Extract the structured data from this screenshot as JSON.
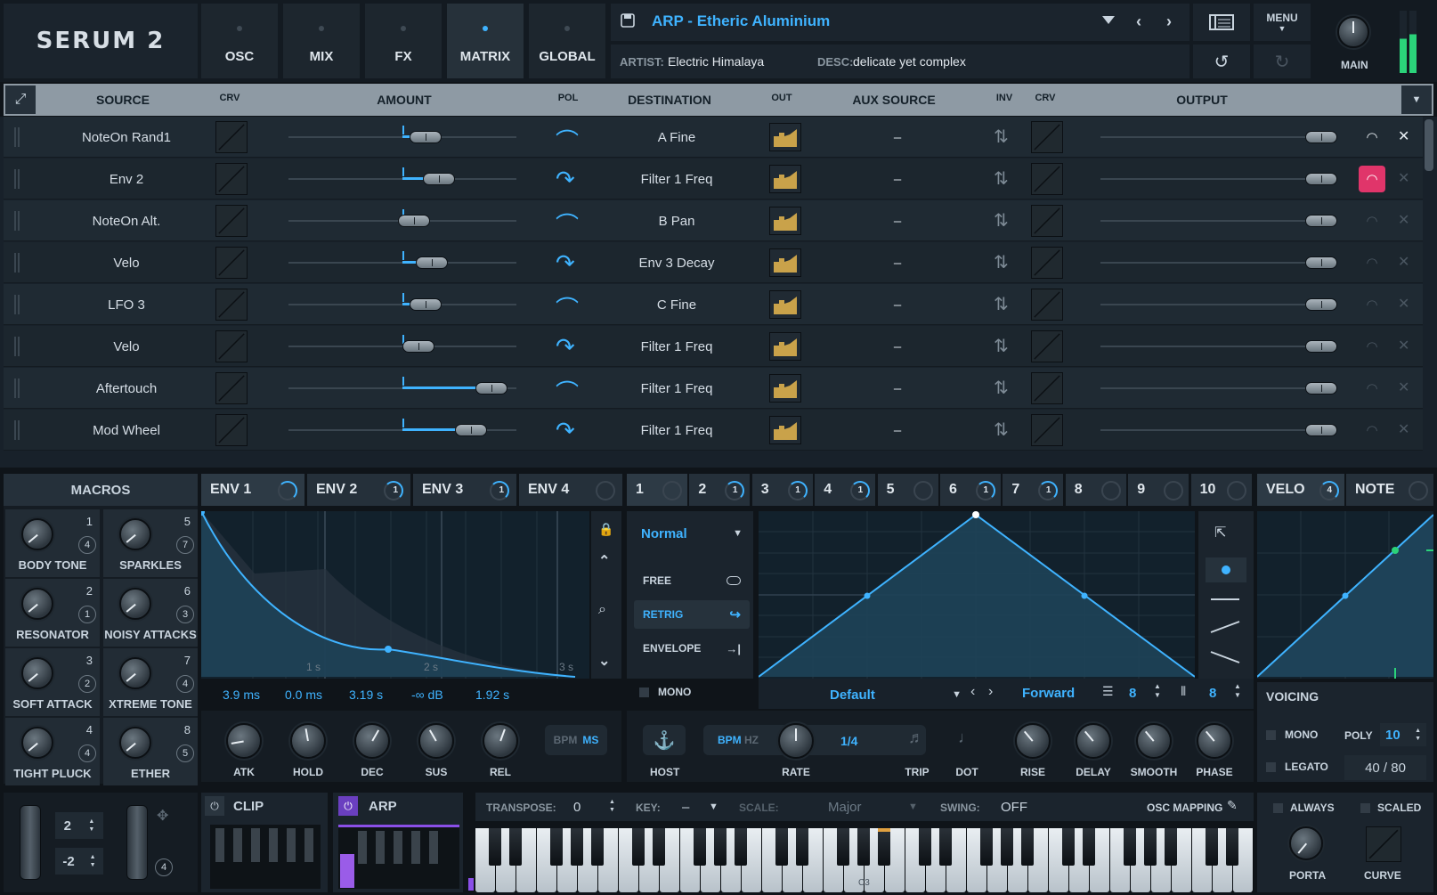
{
  "app": {
    "logo": "SERUM 2"
  },
  "tabs": [
    {
      "label": "OSC",
      "active": false
    },
    {
      "label": "MIX",
      "active": false
    },
    {
      "label": "FX",
      "active": false
    },
    {
      "label": "MATRIX",
      "active": true
    },
    {
      "label": "GLOBAL",
      "active": false
    }
  ],
  "preset": {
    "name": "ARP - Etheric Aluminium",
    "artist_label": "ARTIST:",
    "artist": "Electric Himalaya",
    "desc_label": "DESC:",
    "desc": "delicate yet complex"
  },
  "menu_label": "MENU",
  "main_label": "MAIN",
  "matrix": {
    "headers": {
      "source": "SOURCE",
      "crv": "CRV",
      "amount": "AMOUNT",
      "pol": "POL",
      "destination": "DESTINATION",
      "out": "OUT",
      "aux": "AUX SOURCE",
      "inv": "INV",
      "crv2": "CRV",
      "output": "OUTPUT"
    },
    "rows": [
      {
        "source": "NoteOn Rand1",
        "destination": "A Fine",
        "aux": "–",
        "amount": 0.6
      },
      {
        "source": "Env 2",
        "destination": "Filter 1 Freq",
        "aux": "–",
        "amount": 0.66
      },
      {
        "source": "NoteOn Alt.",
        "destination": "B Pan",
        "aux": "–",
        "amount": 0.55
      },
      {
        "source": "Velo",
        "destination": "Env 3 Decay",
        "aux": "–",
        "amount": 0.63
      },
      {
        "source": "LFO 3",
        "destination": "C Fine",
        "aux": "–",
        "amount": 0.6
      },
      {
        "source": "Velo",
        "destination": "Filter 1 Freq",
        "aux": "–",
        "amount": 0.57
      },
      {
        "source": "Aftertouch",
        "destination": "Filter 1 Freq",
        "aux": "–",
        "amount": 0.89
      },
      {
        "source": "Mod Wheel",
        "destination": "Filter 1 Freq",
        "aux": "–",
        "amount": 0.8
      }
    ]
  },
  "macros": {
    "title": "MACROS",
    "items": [
      {
        "name": "BODY TONE",
        "num": "1",
        "badge": "4"
      },
      {
        "name": "SPARKLES",
        "num": "5",
        "badge": "7"
      },
      {
        "name": "RESONATOR",
        "num": "2",
        "badge": "1"
      },
      {
        "name": "NOISY ATTACKS",
        "num": "6",
        "badge": "3"
      },
      {
        "name": "SOFT ATTACK",
        "num": "3",
        "badge": "2"
      },
      {
        "name": "XTREME TONE",
        "num": "7",
        "badge": "4"
      },
      {
        "name": "TIGHT PLUCK",
        "num": "4",
        "badge": "4"
      },
      {
        "name": "ETHER",
        "num": "8",
        "badge": "5"
      }
    ]
  },
  "env_tabs": [
    {
      "label": "ENV 1",
      "badge": ""
    },
    {
      "label": "ENV 2",
      "badge": "1"
    },
    {
      "label": "ENV 3",
      "badge": "1"
    },
    {
      "label": "ENV 4",
      "badge": ""
    }
  ],
  "env": {
    "time_labels": [
      "1 s",
      "2 s",
      "3 s"
    ],
    "values": [
      "3.9 ms",
      "0.0 ms",
      "3.19 s",
      "-∞ dB",
      "1.92 s"
    ],
    "knobs": [
      "ATK",
      "HOLD",
      "DEC",
      "SUS",
      "REL"
    ],
    "bpm": "BPM",
    "ms": "MS"
  },
  "lfo_tabs": [
    {
      "label": "1",
      "badge": ""
    },
    {
      "label": "2",
      "badge": "1"
    },
    {
      "label": "3",
      "badge": "1"
    },
    {
      "label": "4",
      "badge": "1"
    },
    {
      "label": "5",
      "badge": ""
    },
    {
      "label": "6",
      "badge": "1"
    },
    {
      "label": "7",
      "badge": "1"
    },
    {
      "label": "8",
      "badge": ""
    },
    {
      "label": "9",
      "badge": ""
    },
    {
      "label": "10",
      "badge": ""
    }
  ],
  "lfo": {
    "mode": "Normal",
    "free": "FREE",
    "retrig": "RETRIG",
    "envelope": "ENVELOPE",
    "mono": "MONO",
    "preset": "Default",
    "direction": "Forward",
    "grid_x": "8",
    "grid_y": "8",
    "host": "HOST",
    "bpm": "BPM",
    "hz": "HZ",
    "rate_value": "1/4",
    "knobs": [
      "RATE",
      "TRIP",
      "DOT",
      "RISE",
      "DELAY",
      "SMOOTH",
      "PHASE"
    ]
  },
  "velo_tabs": [
    {
      "label": "VELO",
      "badge": "4"
    },
    {
      "label": "NOTE",
      "badge": ""
    }
  ],
  "voicing": {
    "title": "VOICING",
    "mono": "MONO",
    "legato": "LEGATO",
    "poly_label": "POLY",
    "poly": "10",
    "voices": "40 / 80"
  },
  "bottom": {
    "pitch_up": "2",
    "pitch_down": "-2",
    "mod_badge": "4",
    "clip": "CLIP",
    "arp": "ARP",
    "transpose_label": "TRANSPOSE:",
    "transpose": "0",
    "key_label": "KEY:",
    "key": "–",
    "scale_label": "SCALE:",
    "scale": "Major",
    "swing_label": "SWING:",
    "swing": "OFF",
    "osc_mapping": "OSC MAPPING",
    "always": "ALWAYS",
    "scaled": "SCALED",
    "porta": "PORTA",
    "curve": "CURVE",
    "c3": "C3"
  },
  "colors": {
    "accent": "#3fb3ff",
    "out_gold": "#c9a24a",
    "warn_pink": "#e0356a"
  }
}
